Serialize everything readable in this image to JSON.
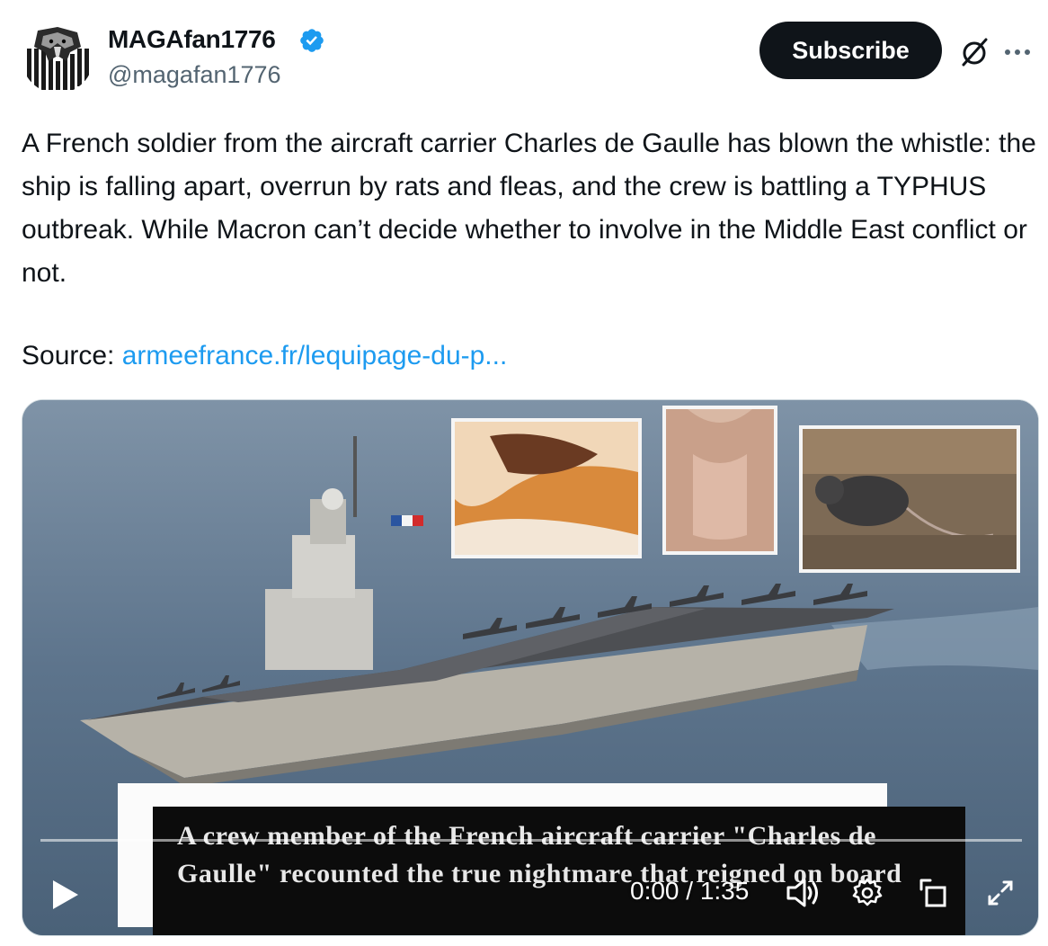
{
  "author": {
    "name": "MAGAfan1776",
    "handle": "@magafan1776",
    "verified": true
  },
  "actions": {
    "subscribe_label": "Subscribe",
    "grok_icon": "grok-icon",
    "more_icon": "more-icon"
  },
  "tweet": {
    "text": "A French soldier from the aircraft carrier Charles de Gaulle has blown the whistle: the ship is falling apart, overrun by rats and fleas, and the crew is battling a TYPHUS outbreak. While Macron can’t decide whether to involve in the Middle East conflict or not.",
    "source_label": "Source: ",
    "source_link": "armeefrance.fr/lequipage-du-p..."
  },
  "video": {
    "caption": "A crew member of the French aircraft carrier \"Charles de Gaulle\" recounted the true nightmare that reigned on board",
    "time": "0:00 / 1:35",
    "progress": 0
  },
  "colors": {
    "link": "#1d9bf0",
    "verified": "#1d9bf0",
    "subscribe_bg": "#0f1419",
    "handle": "#536471"
  }
}
